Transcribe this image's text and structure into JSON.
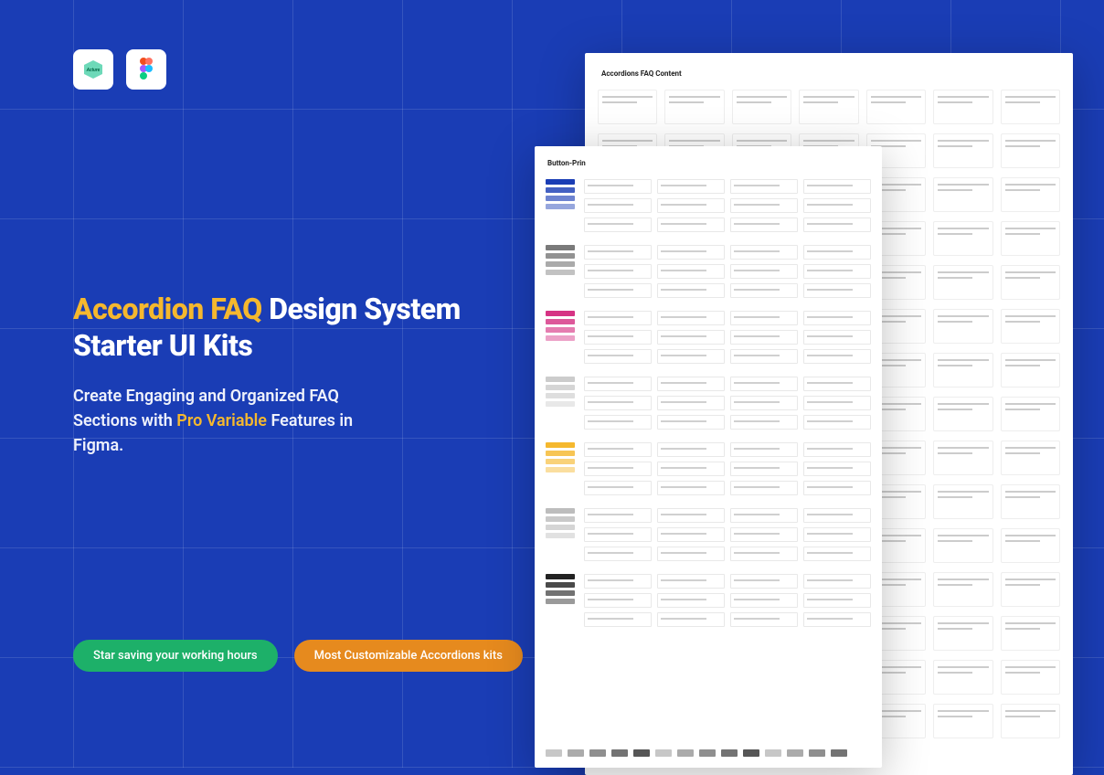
{
  "logos": {
    "acture": "Acture",
    "figma": "Figma"
  },
  "heading": {
    "accent": "Accordion FAQ",
    "rest": " Design System Starter UI Kits"
  },
  "subheading": {
    "pre": "Create Engaging and Organized FAQ Sections with ",
    "accent": "Pro Variable",
    "post": " Features in Figma."
  },
  "pills": {
    "green": "Star saving your working hours",
    "orange": "Most Customizable Accordions kits"
  },
  "mock": {
    "back_title": "Accordions FAQ Content",
    "front_title": "Button-Prin",
    "section_colors": [
      "#1a3db5",
      "#7a7a7a",
      "#d63384",
      "#cccccc",
      "#f5b82e",
      "#bdbdbd",
      "#222222"
    ]
  }
}
